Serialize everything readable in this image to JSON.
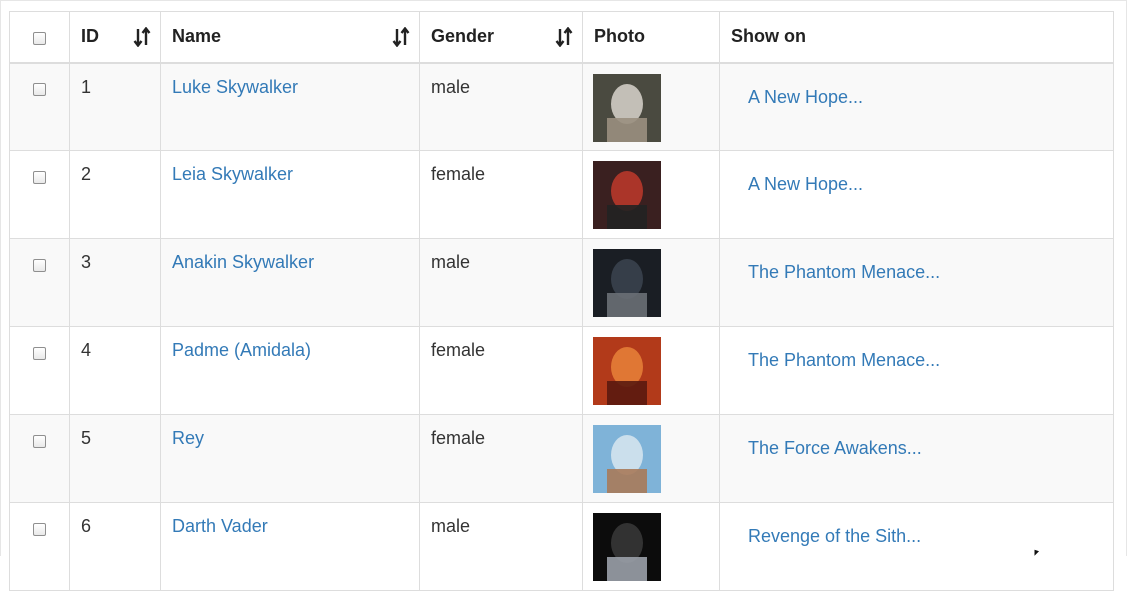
{
  "table": {
    "columns": {
      "id": "ID",
      "name": "Name",
      "gender": "Gender",
      "photo": "Photo",
      "show_on": "Show on"
    },
    "rows": [
      {
        "id": "1",
        "name": "Luke Skywalker",
        "gender": "male",
        "show_on": "A New Hope...",
        "photo_colors": [
          "#4a4a40",
          "#d8d4cc",
          "#9a8f7f"
        ]
      },
      {
        "id": "2",
        "name": "Leia Skywalker",
        "gender": "female",
        "show_on": "A New Hope...",
        "photo_colors": [
          "#3a2020",
          "#c0392b",
          "#222222"
        ]
      },
      {
        "id": "3",
        "name": "Anakin Skywalker",
        "gender": "male",
        "show_on": "The Phantom Menace...",
        "photo_colors": [
          "#1a1e24",
          "#3c4450",
          "#6a6f76"
        ]
      },
      {
        "id": "4",
        "name": "Padme (Amidala)",
        "gender": "female",
        "show_on": "The Phantom Menace...",
        "photo_colors": [
          "#b23a1a",
          "#e8823a",
          "#5a1a10"
        ]
      },
      {
        "id": "5",
        "name": "Rey",
        "gender": "female",
        "show_on": "The Force Awakens...",
        "photo_colors": [
          "#7fb3d8",
          "#d8e6f0",
          "#a87a5a"
        ]
      },
      {
        "id": "6",
        "name": "Darth Vader",
        "gender": "male",
        "show_on": "Revenge of the Sith...",
        "photo_colors": [
          "#0c0c0c",
          "#3a3a3a",
          "#9aa0a8"
        ]
      }
    ]
  },
  "colors": {
    "link": "#337ab7",
    "row_stripe": "#f9f9f9",
    "border": "#dddddd"
  }
}
